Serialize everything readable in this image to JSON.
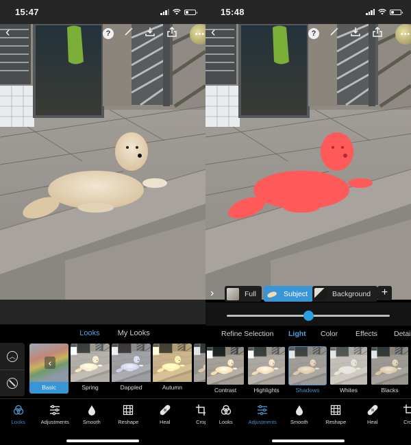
{
  "screens": [
    {
      "status_time": "15:47",
      "mode": "looks",
      "tabs": [
        {
          "label": "Looks",
          "active": true
        },
        {
          "label": "My Looks",
          "active": false
        }
      ],
      "looks": [
        {
          "label": "Basic",
          "active": true
        },
        {
          "label": "Spring",
          "active": false
        },
        {
          "label": "Dappled",
          "active": false
        },
        {
          "label": "Autumn",
          "active": false
        },
        {
          "label": "V",
          "active": false
        }
      ],
      "active_nav": "Looks"
    },
    {
      "status_time": "15:48",
      "mode": "adjustments",
      "selection_chips": [
        {
          "label": "Full",
          "active": false
        },
        {
          "label": "Subject",
          "active": true
        },
        {
          "label": "Background",
          "active": false
        }
      ],
      "add_label": "+",
      "slider_value": 0.5,
      "tabs": [
        {
          "label": "Refine Selection",
          "active": false
        },
        {
          "label": "Light",
          "active": true
        },
        {
          "label": "Color",
          "active": false
        },
        {
          "label": "Effects",
          "active": false
        },
        {
          "label": "Detail",
          "active": false
        }
      ],
      "presets": [
        {
          "label": "Contrast",
          "active": false
        },
        {
          "label": "Highlights",
          "active": false
        },
        {
          "label": "Shadows",
          "active": true
        },
        {
          "label": "Whites",
          "active": false
        },
        {
          "label": "Blacks",
          "active": false
        }
      ],
      "active_nav": "Adjustments",
      "mask_color": "#ff5a5a"
    }
  ],
  "top_actions": {
    "back": "‹",
    "help": "?",
    "more": "•••"
  },
  "nav": [
    {
      "label": "Looks",
      "icon": "looks-icon"
    },
    {
      "label": "Adjustments",
      "icon": "sliders-icon"
    },
    {
      "label": "Smooth",
      "icon": "drop-icon"
    },
    {
      "label": "Reshape",
      "icon": "grid-icon"
    },
    {
      "label": "Heal",
      "icon": "bandage-icon"
    },
    {
      "label": "Crop",
      "icon": "crop-icon"
    }
  ],
  "colors": {
    "accent": "#3996d6",
    "accent_text": "#4aa3df"
  }
}
